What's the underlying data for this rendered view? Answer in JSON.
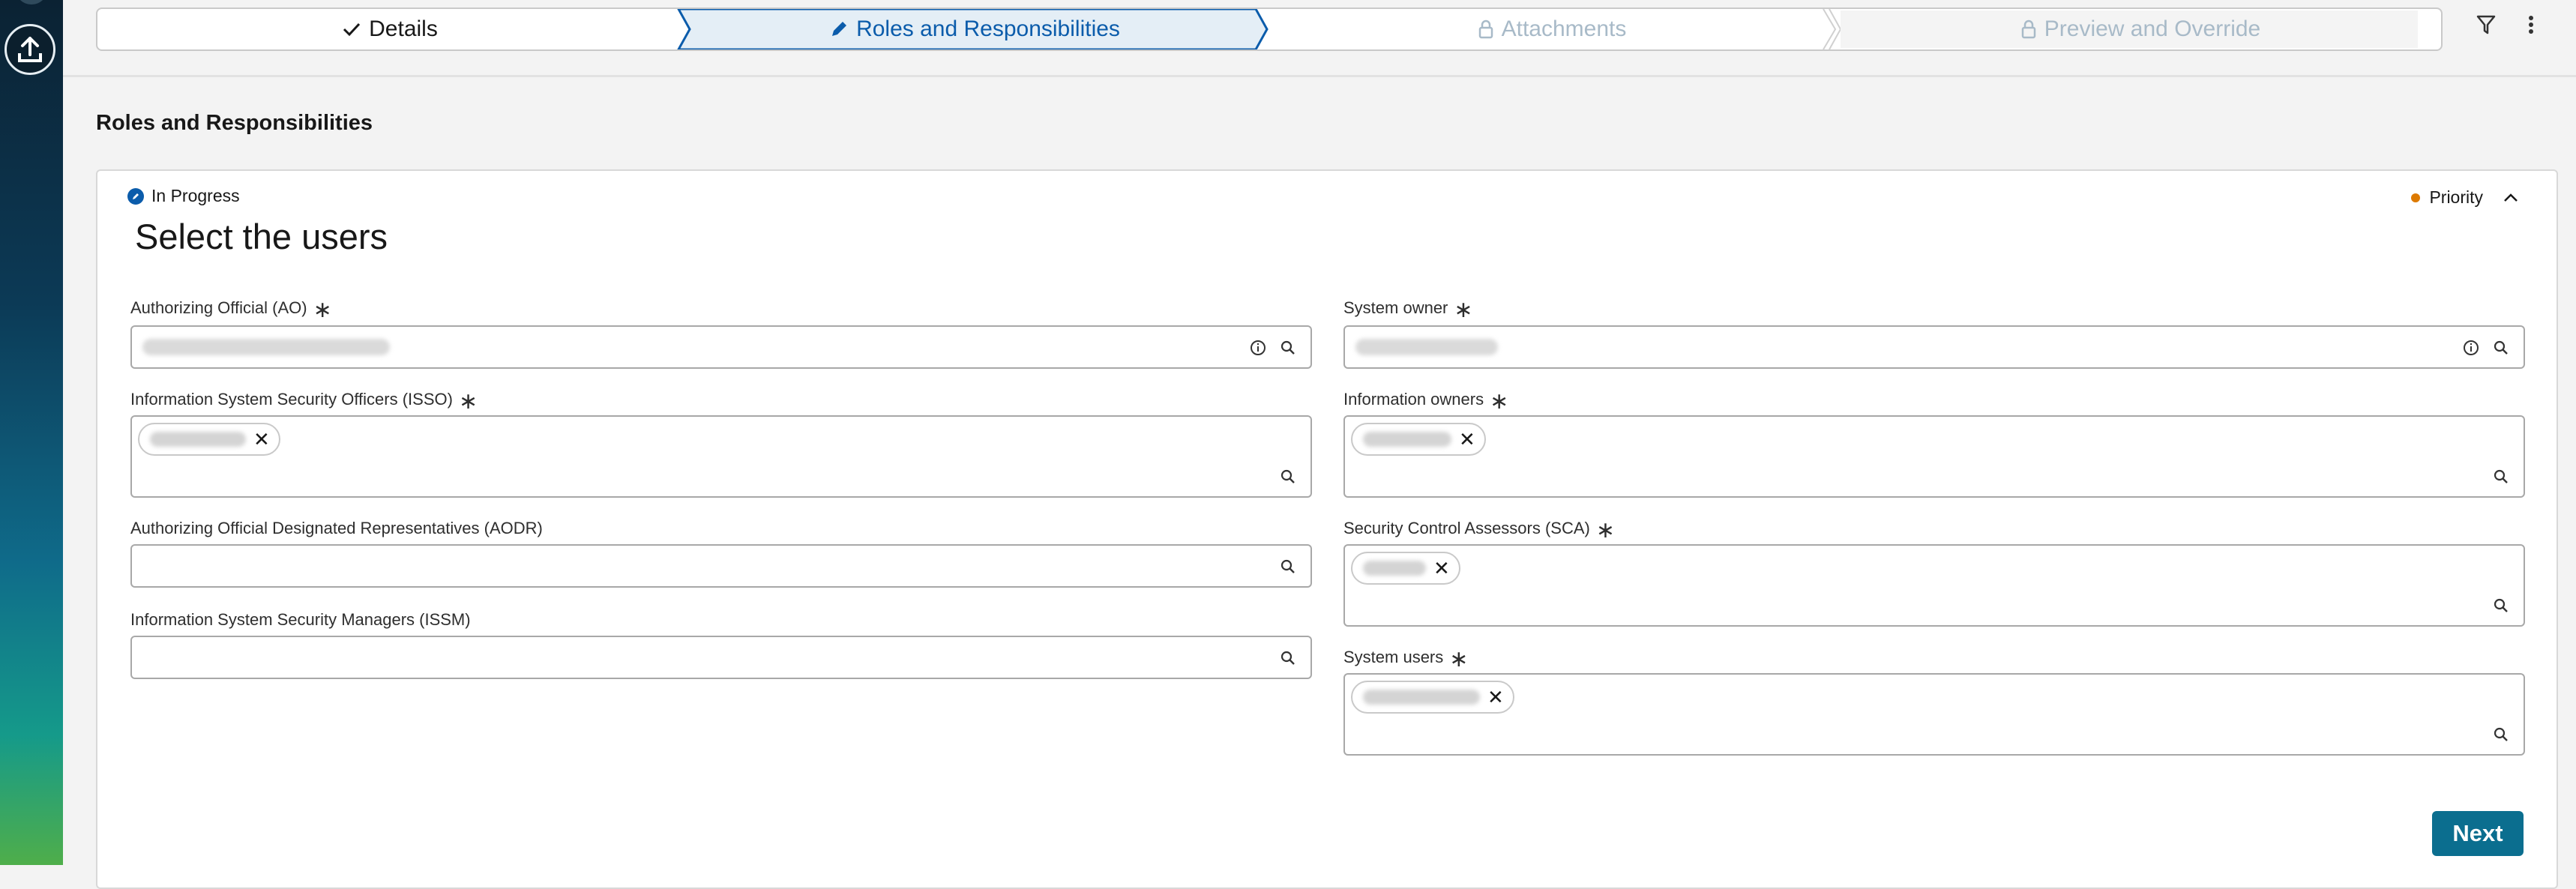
{
  "path": {
    "steps": [
      {
        "label": "Details",
        "state": "complete",
        "icon": "check-icon"
      },
      {
        "label": "Roles and Responsibilities",
        "state": "current",
        "icon": "pencil-icon"
      },
      {
        "label": "Attachments",
        "state": "locked",
        "icon": "lock-icon"
      },
      {
        "label": "Preview and Override",
        "state": "locked",
        "icon": "lock-icon"
      }
    ],
    "right_icons": [
      "filter-icon",
      "more-vertical-icon"
    ]
  },
  "page": {
    "title": "Roles and Responsibilities"
  },
  "card": {
    "status": "In Progress",
    "priority": "Priority",
    "heading": "Select the users"
  },
  "fields": {
    "ao": {
      "label": "Authorizing Official (AO)",
      "required": true
    },
    "isso": {
      "label": "Information System Security Officers (ISSO)",
      "required": true
    },
    "aodr": {
      "label": "Authorizing Official Designated Representatives (AODR)",
      "required": false
    },
    "issm": {
      "label": "Information System Security Managers (ISSM)",
      "required": false
    },
    "system_owner": {
      "label": "System owner",
      "required": true
    },
    "info_owners": {
      "label": "Information owners",
      "required": true
    },
    "sca": {
      "label": "Security Control Assessors (SCA)",
      "required": true
    },
    "system_users": {
      "label": "System users",
      "required": true
    }
  },
  "footer": {
    "next_label": "Next"
  },
  "colors": {
    "accent": "#0b5cab",
    "next_button": "#0b6e8f",
    "priority_dot": "#dd7a01"
  }
}
